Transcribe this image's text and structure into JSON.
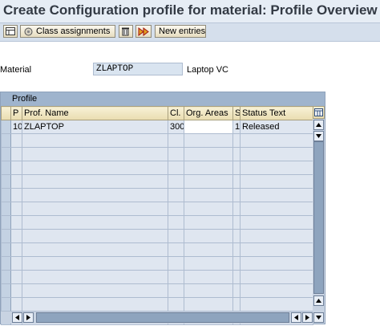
{
  "title": "Create Configuration profile for material: Profile Overview",
  "toolbar": {
    "class_assignments_label": "Class assignments",
    "new_entries_label": "New entries"
  },
  "material": {
    "label": "Material",
    "value": "ZLAPTOP",
    "description": "Laptop VC"
  },
  "profile_table": {
    "frame_title": "Profile",
    "columns": [
      "P",
      "Prof. Name",
      "Cl.",
      "Org. Areas",
      "S",
      "Status Text"
    ],
    "rows": [
      {
        "priority": "10",
        "prof_name": "ZLAPTOP",
        "class_type": "300",
        "org_areas": "",
        "status": "1",
        "status_text": "Released"
      }
    ]
  }
}
